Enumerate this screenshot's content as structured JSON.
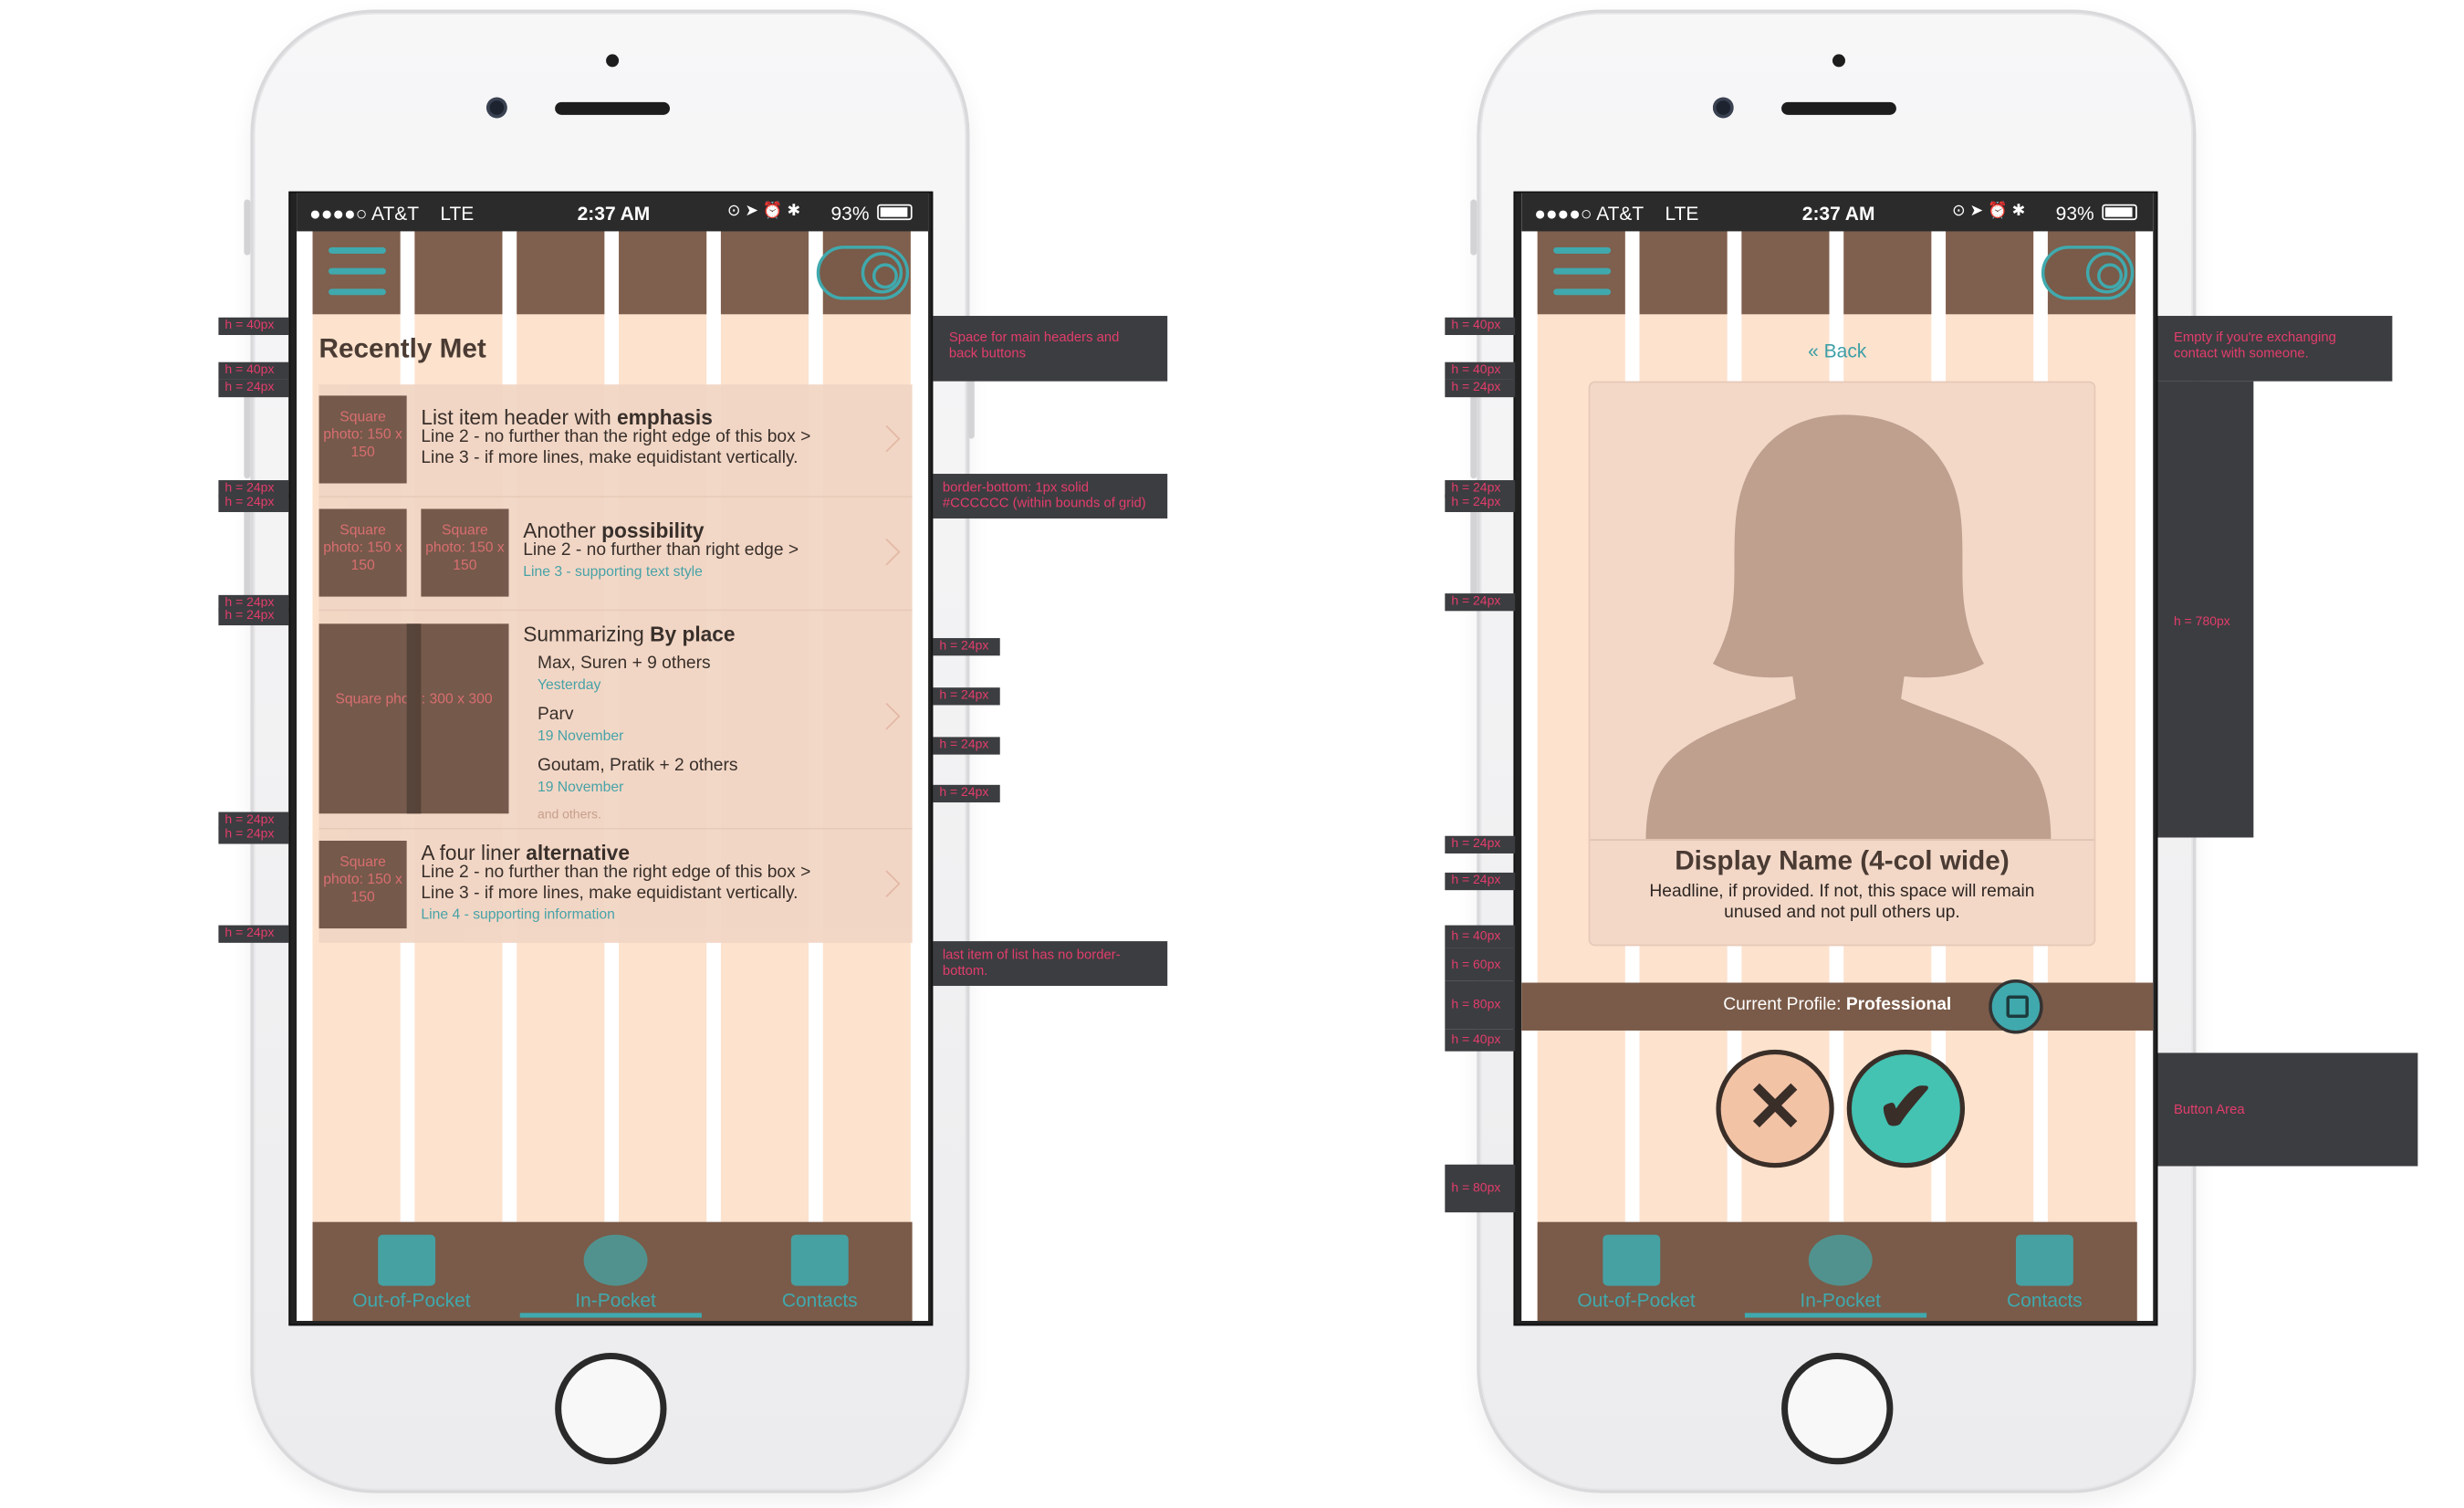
{
  "status": {
    "carrier": "●●●●○ AT&T",
    "network": "LTE",
    "time": "2:37 AM",
    "battery": "93%"
  },
  "left": {
    "heading": "Recently Met",
    "items": [
      {
        "title_a": "List item header with ",
        "title_b": "emphasis",
        "line2": "Line 2 - no further than the right edge of this box >",
        "line3": "Line 3 - if more lines, make equidistant vertically.",
        "photo": "Square photo: 150 x 150"
      },
      {
        "title_a": "Another ",
        "title_b": "possibility",
        "line2": "Line 2 - no further than right edge >",
        "line3": "Line 3 - supporting text style",
        "photo": "Square photo: 150 x 150"
      },
      {
        "title_a": "Summarizing ",
        "title_b": "By place",
        "photo": "Square photo: 300 x 300",
        "sub": [
          {
            "name": "Max, Suren + 9 others",
            "date": "Yesterday"
          },
          {
            "name": "Parv",
            "date": "19 November"
          },
          {
            "name": "Goutam, Pratik + 2 others",
            "date": "19 November"
          }
        ],
        "more": "and others."
      },
      {
        "title_a": "A four liner ",
        "title_b": "alternative",
        "line2": "Line 2 - no further than the right edge of this box >",
        "line3": "Line 3 - if more lines, make equidistant vertically.",
        "line4": "Line 4 - supporting information",
        "photo": "Square photo: 150 x 150"
      }
    ]
  },
  "right": {
    "back": "« Back",
    "display_name": "Display Name (4-col wide)",
    "headline": "Headline, if provided. If not, this space will remain unused and not pull others up.",
    "profile_label": "Current Profile: ",
    "profile_value": "Professional"
  },
  "tabs": [
    "Out-of-Pocket",
    "In-Pocket",
    "Contacts"
  ],
  "annotations": {
    "h40": "h = 40px",
    "h24": "h = 24px",
    "h60": "h = 60px",
    "h80": "h = 80px",
    "h780": "h = 780px",
    "space_headers": "Space for main headers and back buttons",
    "border_bottom": "border-bottom: 1px solid #CCCCCC (within bounds of grid)",
    "last_item": "last item of list has no border-bottom.",
    "empty_exchange": "Empty if you're exchanging contact with someone.",
    "button_area": "Button Area"
  },
  "colors": {
    "accent": "#40a9ad",
    "grid": "#fde2cd",
    "gutter_dark": "#7a5a48",
    "annotation_bg": "#3c3d40",
    "annotation_text": "#e23d6c"
  }
}
